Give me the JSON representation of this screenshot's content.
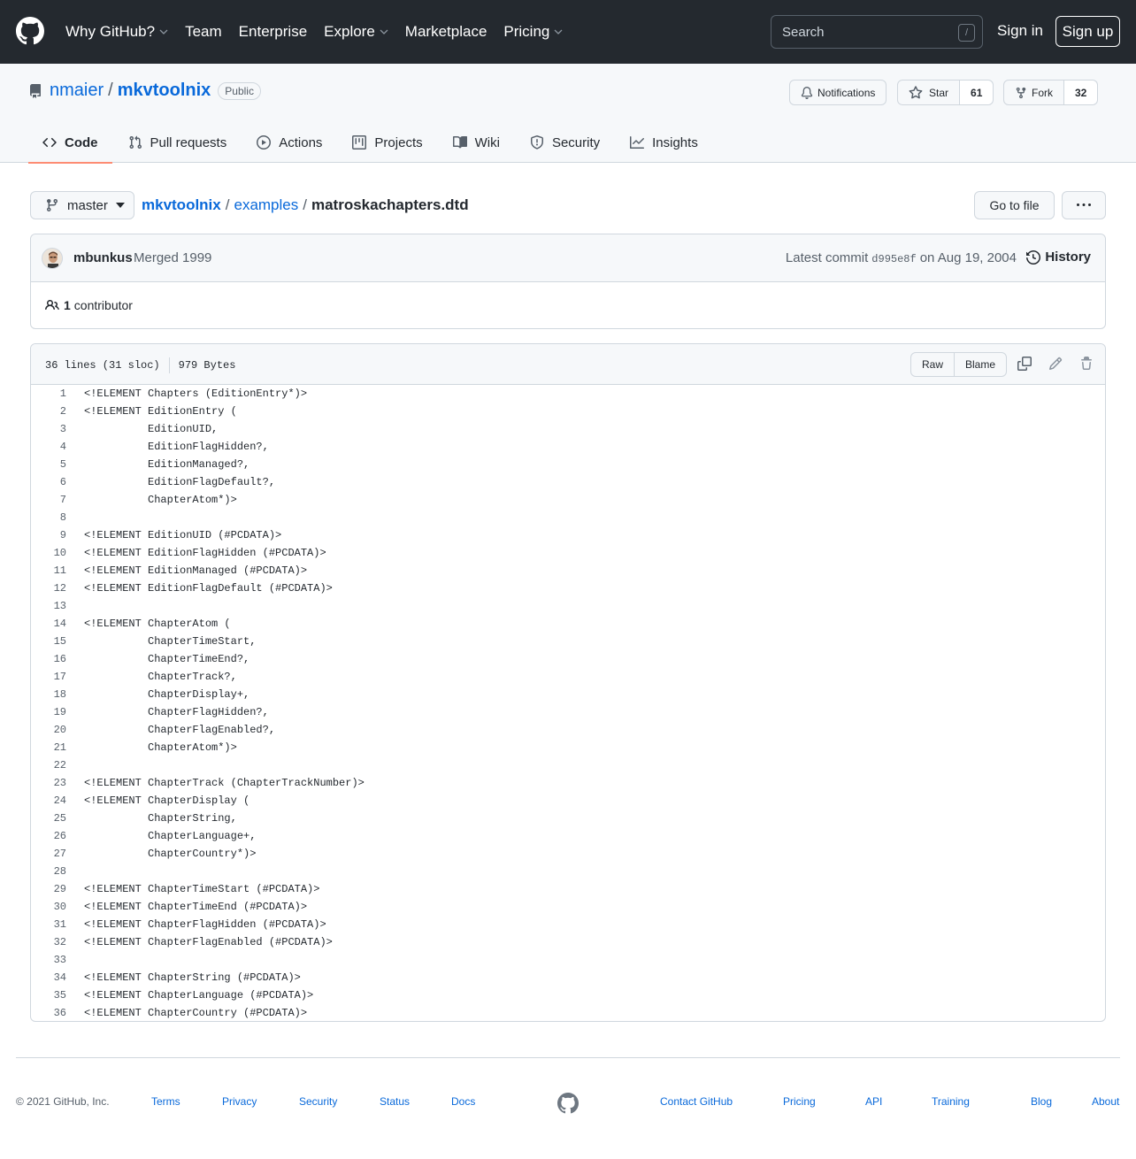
{
  "header": {
    "nav": [
      {
        "label": "Why GitHub?",
        "caret": true
      },
      {
        "label": "Team",
        "caret": false
      },
      {
        "label": "Enterprise",
        "caret": false
      },
      {
        "label": "Explore",
        "caret": true
      },
      {
        "label": "Marketplace",
        "caret": false
      },
      {
        "label": "Pricing",
        "caret": true
      }
    ],
    "search_placeholder": "Search",
    "search_shortcut": "/",
    "sign_in": "Sign in",
    "sign_up": "Sign up"
  },
  "repo": {
    "owner": "nmaier",
    "separator": "/",
    "name": "mkvtoolnix",
    "visibility": "Public",
    "notifications_label": "Notifications",
    "star_label": "Star",
    "star_count": "61",
    "fork_label": "Fork",
    "fork_count": "32",
    "tabs": [
      {
        "label": "Code",
        "icon": "code-icon",
        "active": true
      },
      {
        "label": "Pull requests",
        "icon": "pull-request-icon",
        "active": false
      },
      {
        "label": "Actions",
        "icon": "play-icon",
        "active": false
      },
      {
        "label": "Projects",
        "icon": "project-icon",
        "active": false
      },
      {
        "label": "Wiki",
        "icon": "book-icon",
        "active": false
      },
      {
        "label": "Security",
        "icon": "shield-icon",
        "active": false
      },
      {
        "label": "Insights",
        "icon": "graph-icon",
        "active": false
      }
    ]
  },
  "file_nav": {
    "branch": "master",
    "breadcrumb_root": "mkvtoolnix",
    "breadcrumb_dir": "examples",
    "breadcrumb_sep": "/",
    "file_name": "matroskachapters.dtd",
    "go_to_file": "Go to file"
  },
  "commit": {
    "author": "mbunkus",
    "message": "Merged 1999",
    "latest_label": "Latest commit",
    "sha": "d995e8f",
    "date": "on Aug 19, 2004",
    "history_label": "History",
    "contributors_count": "1",
    "contributors_label": "contributor"
  },
  "file": {
    "lines_info": "36 lines (31 sloc)",
    "size": "979 Bytes",
    "raw_label": "Raw",
    "blame_label": "Blame",
    "lines": [
      "<!ELEMENT Chapters (EditionEntry*)>",
      "<!ELEMENT EditionEntry (",
      "          EditionUID,",
      "          EditionFlagHidden?,",
      "          EditionManaged?,",
      "          EditionFlagDefault?,",
      "          ChapterAtom*)>",
      "",
      "<!ELEMENT EditionUID (#PCDATA)>",
      "<!ELEMENT EditionFlagHidden (#PCDATA)>",
      "<!ELEMENT EditionManaged (#PCDATA)>",
      "<!ELEMENT EditionFlagDefault (#PCDATA)>",
      "",
      "<!ELEMENT ChapterAtom (",
      "          ChapterTimeStart,",
      "          ChapterTimeEnd?,",
      "          ChapterTrack?,",
      "          ChapterDisplay+,",
      "          ChapterFlagHidden?,",
      "          ChapterFlagEnabled?,",
      "          ChapterAtom*)>",
      "",
      "<!ELEMENT ChapterTrack (ChapterTrackNumber)>",
      "<!ELEMENT ChapterDisplay (",
      "          ChapterString,",
      "          ChapterLanguage+,",
      "          ChapterCountry*)>",
      "",
      "<!ELEMENT ChapterTimeStart (#PCDATA)>",
      "<!ELEMENT ChapterTimeEnd (#PCDATA)>",
      "<!ELEMENT ChapterFlagHidden (#PCDATA)>",
      "<!ELEMENT ChapterFlagEnabled (#PCDATA)>",
      "",
      "<!ELEMENT ChapterString (#PCDATA)>",
      "<!ELEMENT ChapterLanguage (#PCDATA)>",
      "<!ELEMENT ChapterCountry (#PCDATA)>"
    ]
  },
  "footer": {
    "copyright": "© 2021 GitHub, Inc.",
    "links": [
      "Terms",
      "Privacy",
      "Security",
      "Status",
      "Docs",
      "Contact GitHub",
      "Pricing",
      "API",
      "Training",
      "Blog",
      "About"
    ]
  },
  "colors": {
    "header_bg": "#24292f",
    "link": "#0969da",
    "active_tab_underline": "#fd8c73",
    "border": "#d0d7de"
  }
}
